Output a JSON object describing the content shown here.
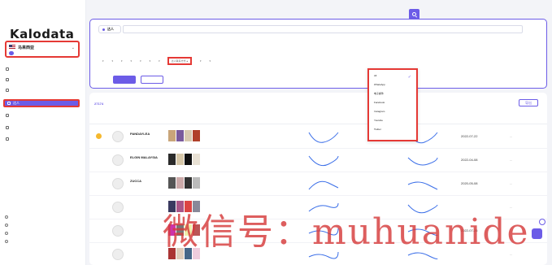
{
  "brand": {
    "logo_text": "Kalodata"
  },
  "region": {
    "name": "马来西亚",
    "badge": ""
  },
  "sidebar": {
    "items": [
      {
        "label": ""
      },
      {
        "label": ""
      },
      {
        "label": ""
      },
      {
        "label": "达人"
      },
      {
        "label": ""
      },
      {
        "label": ""
      },
      {
        "label": ""
      }
    ],
    "footer": [
      {
        "label": ""
      },
      {
        "label": ""
      },
      {
        "label": ""
      },
      {
        "label": ""
      }
    ]
  },
  "filters": {
    "segment_label": "达人",
    "search_placeholder": "",
    "row1": {
      "label": "",
      "chips": [
        "",
        "",
        "",
        "",
        "",
        "",
        "",
        "",
        "",
        "",
        "",
        "",
        "",
        "",
        "",
        "",
        "",
        "",
        "",
        ""
      ],
      "selected_index": 0
    },
    "row2": {
      "label": "",
      "dropdowns": [
        "",
        "",
        "",
        "",
        "",
        "",
        "",
        "",
        ""
      ],
      "highlighted": "达人联系方式",
      "extra": [
        "",
        ""
      ]
    },
    "apply_label": "",
    "reset_label": ""
  },
  "contact_menu": {
    "options": [
      "All",
      "WhatsApp",
      "电子邮件",
      "Facebook",
      "Instagram",
      "Youtube",
      "Twitter"
    ],
    "selected": "All"
  },
  "results": {
    "total_prefix": "",
    "total_count": "27174",
    "total_suffix": "",
    "export_label": "导出",
    "columns": [
      "",
      "",
      "",
      "",
      "",
      "",
      "",
      "",
      "",
      ""
    ],
    "rows": [
      {
        "rank": "",
        "name": "PANDAYLEA",
        "handle": "",
        "followers": "",
        "revenue": "",
        "col3": "",
        "date": "2022-07-22",
        "more": "..."
      },
      {
        "rank": "",
        "name": "ELGIN MALAYSIA",
        "handle": "",
        "followers": "",
        "revenue": "",
        "col3": "",
        "date": "2022-04-08",
        "more": "..."
      },
      {
        "rank": "",
        "name": "ZUCCA",
        "handle": "",
        "followers": "",
        "revenue": "",
        "col3": "",
        "date": "2020-05-08",
        "more": "..."
      },
      {
        "rank": "",
        "name": "",
        "handle": "",
        "followers": "",
        "revenue": "",
        "col3": "",
        "date": "",
        "more": "..."
      },
      {
        "rank": "",
        "name": "",
        "handle": "",
        "followers": "",
        "revenue": "",
        "col3": "",
        "date": "2022-07-26",
        "more": "..."
      },
      {
        "rank": "",
        "name": "",
        "handle": "",
        "followers": "",
        "revenue": "",
        "col3": "",
        "date": "",
        "more": "..."
      }
    ]
  },
  "watermark": {
    "text": "微信号：muhuanide"
  },
  "colors": {
    "accent": "#6c5ce7",
    "highlight": "#e53935"
  }
}
